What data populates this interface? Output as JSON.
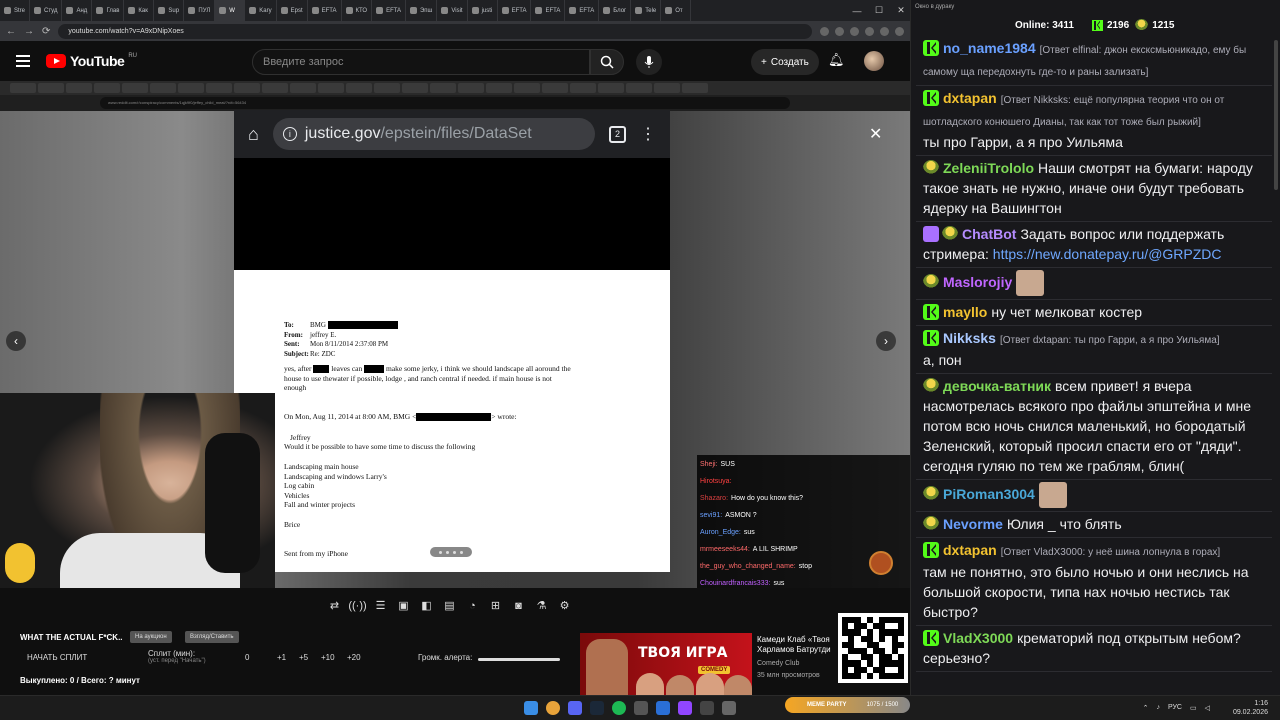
{
  "browser": {
    "tabs": [
      "Stre",
      "Студ",
      "Анд",
      "Глав",
      "Как",
      "Sup",
      "ПУЛ",
      "W",
      "Kary",
      "Epst",
      "EFTA",
      "КТО",
      "EFTA",
      "Эпш",
      "Visit",
      "justi",
      "EFTA",
      "EFTA",
      "EFTA",
      "Блог",
      "Tele",
      "От"
    ],
    "active_tab_index": 7,
    "url": "youtube.com/watch?v=A9xDNipXoes",
    "chat_window_title": "Окно в дураку"
  },
  "youtube": {
    "logo_text": "YouTube",
    "region": "RU",
    "search_placeholder": "Введите запрос",
    "create_label": "Создать"
  },
  "video": {
    "inner_url": "www.reddit.com/r/conspiracy/comments/1qjk9f0/jeffey_child_meat/?rdt=56434",
    "phone_url_domain": "justice.gov",
    "phone_url_path": "/epstein/files/DataSet",
    "phone_tab_count": "2",
    "email": {
      "to_label": "To:",
      "to_val": "BMG",
      "from_label": "From:",
      "from_val": "jeffrey E.",
      "sent_label": "Sent:",
      "sent_val": "Mon 8/11/2014 2:37:08 PM",
      "subject_label": "Subject:",
      "subject_val": "Re: ZDC",
      "body1a": "yes, after",
      "body1b": "leaves   can",
      "body1c": "make some jerky,   i think we should landscape all aoround the",
      "body2": "house to use thewater if possible,  lodge , and ranch central if needed.  if main house is not",
      "body3": "enough",
      "quote_a": "On Mon, Aug 11, 2014 at 8:00 AM, BMG <",
      "quote_b": "> wrote:",
      "greeting": "Jeffrey",
      "line1": "Would it be possible to have some time to discuss the following",
      "items": [
        "Landscaping main house",
        "Landscaping and windows  Larry's",
        "Log cabin",
        "Vehicles",
        "Fall and winter projects"
      ],
      "sign": "Brice",
      "sent_from": "Sent from my iPhone"
    },
    "overlay_chat": [
      {
        "user": "Sheji:",
        "text": "SUS",
        "color": "#ff7070"
      },
      {
        "user": "Hirotsuya:",
        "text": "",
        "color": "#ff4040"
      },
      {
        "user": "Shazaro:",
        "text": "How do you know this?",
        "color": "#d94040"
      },
      {
        "user": "sevi91:",
        "text": "ASMON ?",
        "color": "#6aa0ff"
      },
      {
        "user": "Auron_Edge:",
        "text": "sus",
        "color": "#6aa0ff"
      },
      {
        "user": "mrmeeseeks44:",
        "text": "A LIL SHRIMP",
        "color": "#ff6a6a"
      },
      {
        "user": "the_guy_who_changed_name:",
        "text": "stop",
        "color": "#ff6a6a"
      },
      {
        "user": "Chouinardfrancais333:",
        "text": "sus",
        "color": "#c060ff"
      }
    ]
  },
  "bottom": {
    "title": "WHAT THE ACTUAL F*CK..",
    "pill1": "На аукцион",
    "pill2": "Взгляд/Ставить",
    "start_split": "НАЧАТЬ СПЛИТ",
    "split_label": "Сплит (мин):",
    "split_hint": "(уст. перед \"Начать\")",
    "split_vals": [
      "0",
      "+1",
      "+5",
      "+10",
      "+20"
    ],
    "alert_vol": "Громк. алерта:",
    "bought": "Выкуплено: 0 / Всего: ? минут",
    "rec_title_1": "Камеди Клаб «Твоя",
    "rec_title_2": "Харламов Батрутди",
    "rec_channel": "Comedy Club",
    "rec_views": "35 млн просмотров",
    "thumb_text": "ТВОЯ ИГРА",
    "thumb_badge": "COMEDY"
  },
  "chat": {
    "online_label": "Online:",
    "online": "3411",
    "kick_count": "2196",
    "pepe_count": "1215",
    "messages": [
      {
        "user": "no_name1984",
        "color": "#6aa0ff",
        "reply": "[Ответ elfinal: джон ексксмьюникадо, ему бы самому ща передохнуть где-то и раны зализать]",
        "text": "",
        "badge": "k"
      },
      {
        "user": "dxtapan",
        "color": "#f2c230",
        "reply": "[Ответ Nikksks: ещё популярна теория что он от шотладского конюшего Дианы, так как тот тоже был рыжий]",
        "text": "ты про Гарри, а я про Уильяма",
        "badge": "k"
      },
      {
        "user": "ZeleniiTrololo",
        "color": "#7ed957",
        "reply": "",
        "text": "Наши смотрят на бумаги: народу такое знать не нужно, иначе они будут требовать ядерку на Вашингтон",
        "badge": "pepe"
      },
      {
        "user": "ChatBot",
        "color": "#b58cff",
        "reply": "",
        "text": "Задать вопрос или поддержать стримера:",
        "link": "https://new.donatepay.ru/@GRPZDC",
        "badge": "bot"
      },
      {
        "user": "Maslorojiy",
        "color": "#c066ff",
        "reply": "",
        "text": "",
        "badge": "pepe"
      },
      {
        "user": "mayllo",
        "color": "#f2c230",
        "reply": "",
        "text": "ну чет мелковат костер",
        "badge": "k"
      },
      {
        "user": "Nikksks",
        "color": "#a9c8ff",
        "reply": "[Ответ dxtapan: ты про Гарри, а я про Уильяма]",
        "text": "а, пон",
        "badge": "k"
      },
      {
        "user": "девочка-ватник",
        "color": "#7ed957",
        "reply": "",
        "text": "всем привет! я вчера насмотрелась всякого про файлы эпштейна и мне потом всю ночь снился маленький, но бородатый Зеленский, который просил спасти его от \"дяди\". сегодня гуляю по тем же граблям, блин(",
        "badge": "pepe"
      },
      {
        "user": "PiRoman3004",
        "color": "#4aa8d8",
        "reply": "",
        "text": "",
        "badge": "pepe"
      },
      {
        "user": "Nevorme",
        "color": "#6aa0ff",
        "reply": "",
        "text": "Юлия _  что блять",
        "badge": "pepe"
      },
      {
        "user": "dxtapan",
        "color": "#f2c230",
        "reply": "[Ответ VladX3000: у неё шина лопнула в горах]",
        "text": "там не понятно, это было ночью и они неслись на большой скорости, типа нах ночью нестись так быстро?",
        "badge": "k"
      },
      {
        "user": "VladX3000",
        "color": "#7ed957",
        "reply": "",
        "text": "крематорий под открытым небом? серьезно?",
        "badge": "k"
      }
    ]
  },
  "taskbar": {
    "lang": "РУС",
    "time": "1:16",
    "date": "09.02.2026",
    "meme_party": "MEME PARTY",
    "meme_progress": "1075 / 1500"
  }
}
